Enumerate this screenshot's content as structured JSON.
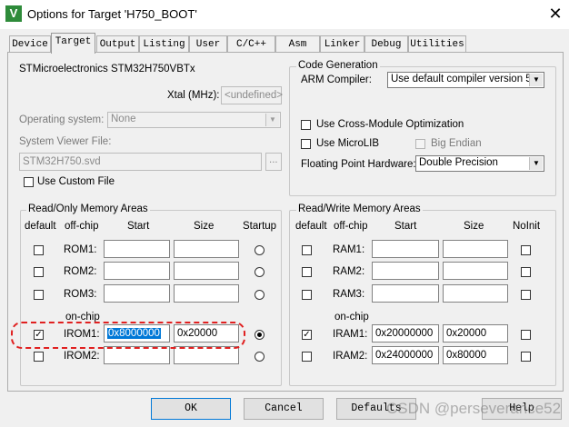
{
  "window": {
    "title": "Options for Target 'H750_BOOT'",
    "app_icon_glyph": "V",
    "close_glyph": "✕"
  },
  "tabs": [
    "Device",
    "Target",
    "Output",
    "Listing",
    "User",
    "C/C++",
    "Asm",
    "Linker",
    "Debug",
    "Utilities"
  ],
  "active_tab": "Target",
  "device_name": "STMicroelectronics STM32H750VBTx",
  "xtal": {
    "label": "Xtal (MHz):",
    "value": "<undefined>"
  },
  "os": {
    "label": "Operating system:",
    "value": "None"
  },
  "svd": {
    "label": "System Viewer File:",
    "value": "STM32H750.svd",
    "browse": "..."
  },
  "custom_file": {
    "label": "Use Custom File",
    "checked": false
  },
  "codegen": {
    "title": "Code Generation",
    "compiler_label": "ARM Compiler:",
    "compiler_value": "Use default compiler version 5",
    "cross_module": {
      "label": "Use Cross-Module Optimization",
      "checked": false
    },
    "microlib": {
      "label": "Use MicroLIB",
      "checked": false
    },
    "big_endian": {
      "label": "Big Endian",
      "checked": false,
      "disabled": true
    },
    "fpu_label": "Floating Point Hardware:",
    "fpu_value": "Double Precision"
  },
  "rom": {
    "title": "Read/Only Memory Areas",
    "headers": {
      "default": "default",
      "offchip": "off-chip",
      "start": "Start",
      "size": "Size",
      "startup": "Startup"
    },
    "onchip_label": "on-chip",
    "rows": [
      {
        "name": "ROM1:",
        "checked": false,
        "start": "",
        "size": "",
        "startup": false
      },
      {
        "name": "ROM2:",
        "checked": false,
        "start": "",
        "size": "",
        "startup": false
      },
      {
        "name": "ROM3:",
        "checked": false,
        "start": "",
        "size": "",
        "startup": false
      },
      {
        "name": "IROM1:",
        "checked": true,
        "start": "0x8000000",
        "size": "0x20000",
        "startup": true
      },
      {
        "name": "IROM2:",
        "checked": false,
        "start": "",
        "size": "",
        "startup": false
      }
    ]
  },
  "ram": {
    "title": "Read/Write Memory Areas",
    "headers": {
      "default": "default",
      "offchip": "off-chip",
      "start": "Start",
      "size": "Size",
      "noinit": "NoInit"
    },
    "onchip_label": "on-chip",
    "rows": [
      {
        "name": "RAM1:",
        "checked": false,
        "start": "",
        "size": "",
        "noinit": false
      },
      {
        "name": "RAM2:",
        "checked": false,
        "start": "",
        "size": "",
        "noinit": false
      },
      {
        "name": "RAM3:",
        "checked": false,
        "start": "",
        "size": "",
        "noinit": false
      },
      {
        "name": "IRAM1:",
        "checked": true,
        "start": "0x20000000",
        "size": "0x20000",
        "noinit": false
      },
      {
        "name": "IRAM2:",
        "checked": false,
        "start": "0x24000000",
        "size": "0x80000",
        "noinit": false
      }
    ]
  },
  "buttons": {
    "ok": "OK",
    "cancel": "Cancel",
    "defaults": "Defaults",
    "help": "Help"
  },
  "watermark": "CSDN @perseverance52",
  "check_glyph": "✓",
  "highlight_color": "#e02020"
}
